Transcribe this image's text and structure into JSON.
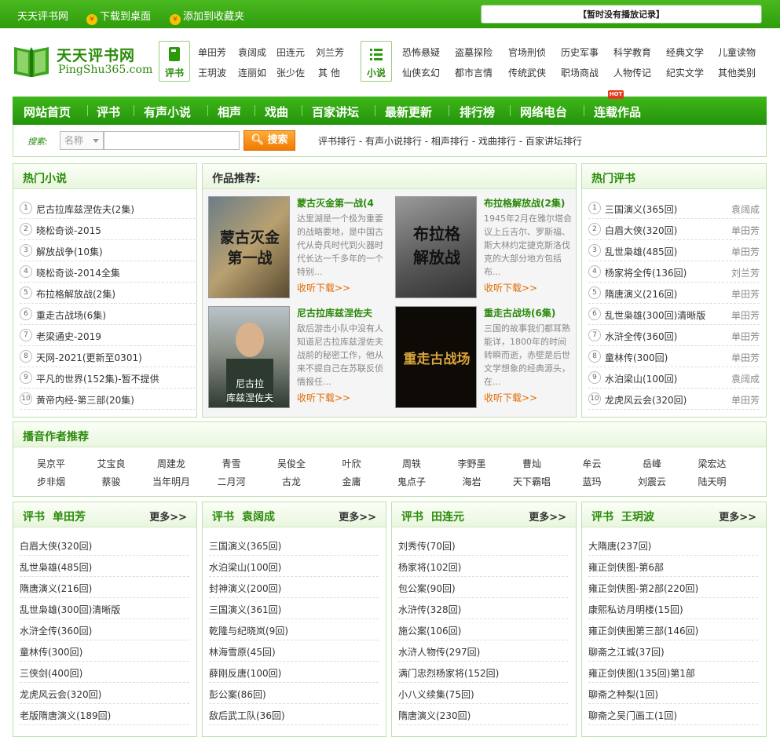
{
  "topbar": {
    "site_name": "天天评书网",
    "download_label": "下载到桌面",
    "favorite_label": "添加到收藏夹",
    "play_record": "【暂时没有播放记录】"
  },
  "logo": {
    "cn": "天天评书网",
    "en": "PingShu365.com"
  },
  "category_pingshu": {
    "label": "评书",
    "row1": [
      "单田芳",
      "袁阔成",
      "田连元",
      "刘兰芳"
    ],
    "row2": [
      "王玥波",
      "连丽如",
      "张少佐",
      "其 他"
    ]
  },
  "category_novel": {
    "label": "小说",
    "row1": [
      "恐怖悬疑",
      "盗墓探险",
      "官场刑侦",
      "历史军事",
      "科学教育",
      "经典文学",
      "儿童读物"
    ],
    "row2": [
      "仙侠玄幻",
      "都市言情",
      "传统武侠",
      "职场商战",
      "人物传记",
      "纪实文学",
      "其他类别"
    ]
  },
  "nav": [
    "网站首页",
    "评书",
    "有声小说",
    "相声",
    "戏曲",
    "百家讲坛",
    "最新更新",
    "排行榜",
    "网络电台",
    "连载作品"
  ],
  "nav_badge": "HOT",
  "search": {
    "label": "搜索:",
    "category": "名称",
    "button": "搜索",
    "links": "评书排行 - 有声小说排行 - 相声排行 - 戏曲排行 - 百家讲坛排行"
  },
  "hot_novels": {
    "title": "热门小说",
    "items": [
      {
        "n": "1",
        "t": "尼古拉库兹涅佐夫(2集)"
      },
      {
        "n": "2",
        "t": "晓松奇谈-2015"
      },
      {
        "n": "3",
        "t": "解放战争(10集)"
      },
      {
        "n": "4",
        "t": "晓松奇谈-2014全集"
      },
      {
        "n": "5",
        "t": "布拉格解放战(2集)"
      },
      {
        "n": "6",
        "t": "重走古战场(6集)"
      },
      {
        "n": "7",
        "t": "老梁通史-2019"
      },
      {
        "n": "8",
        "t": "天网-2021(更新至0301)"
      },
      {
        "n": "9",
        "t": "平凡的世界(152集)-暂不提供"
      },
      {
        "n": "10",
        "t": "黄帝内经-第三部(20集)"
      }
    ]
  },
  "recommend": {
    "title": "作品推荐:",
    "works": [
      {
        "title": "蒙古灭金第一战(4",
        "desc": "达里湖是一个极为重要的战略要地，是中国古代从奇兵时代到火器时代长达一千多年的一个特别...",
        "link": "收听下载>>",
        "cover_text": "蒙古灭金\n第一战"
      },
      {
        "title": "布拉格解放战(2集)",
        "desc": "1945年2月在雅尔塔会议上丘吉尔、罗斯福、斯大林约定捷克斯洛伐克的大部分地方包括布...",
        "link": "收听下载>>",
        "cover_text": "布拉格\n解放战"
      },
      {
        "title": "尼古拉库兹涅佐夫",
        "desc": "敌后游击小队中没有人知道尼古拉库兹涅佐夫战前的秘密工作，他从来不提自己在苏联反侦情报任...",
        "link": "收听下载>>",
        "cover_text": "尼古拉\n库兹涅佐夫"
      },
      {
        "title": "重走古战场(6集)",
        "desc": "三国的故事我们都耳熟能详，1800年的时间转瞬而逝，赤壁是后世文学想象的经典源头，在...",
        "link": "收听下载>>",
        "cover_text": "重走古战场"
      }
    ]
  },
  "hot_pingshu": {
    "title": "热门评书",
    "items": [
      {
        "n": "1",
        "t": "三国演义(365回)",
        "a": "袁阔成"
      },
      {
        "n": "2",
        "t": "白眉大侠(320回)",
        "a": "单田芳"
      },
      {
        "n": "3",
        "t": "乱世枭雄(485回)",
        "a": "单田芳"
      },
      {
        "n": "4",
        "t": "杨家将全传(136回)",
        "a": "刘兰芳"
      },
      {
        "n": "5",
        "t": "隋唐演义(216回)",
        "a": "单田芳"
      },
      {
        "n": "6",
        "t": "乱世枭雄(300回)清晰版",
        "a": "单田芳"
      },
      {
        "n": "7",
        "t": "水浒全传(360回)",
        "a": "单田芳"
      },
      {
        "n": "8",
        "t": "童林传(300回)",
        "a": "单田芳"
      },
      {
        "n": "9",
        "t": "水泊梁山(100回)",
        "a": "袁阔成"
      },
      {
        "n": "10",
        "t": "龙虎风云会(320回)",
        "a": "单田芳"
      }
    ]
  },
  "authors": {
    "title": "播音作者推荐",
    "row1": [
      "吴京平",
      "艾宝良",
      "周建龙",
      "青雪",
      "吴俊全",
      "叶欣",
      "周轶",
      "李野墨",
      "曹灿",
      "牟云",
      "岳峰",
      "梁宏达"
    ],
    "row2": [
      "步非烟",
      "蔡骏",
      "当年明月",
      "二月河",
      "古龙",
      "金庸",
      "鬼点子",
      "海岩",
      "天下霸唱",
      "蓝玛",
      "刘震云",
      "陆天明"
    ]
  },
  "columns": [
    {
      "cat": "评书",
      "name": "单田芳",
      "more": "更多>>",
      "items": [
        "白眉大侠(320回)",
        "乱世枭雄(485回)",
        "隋唐演义(216回)",
        "乱世枭雄(300回)清晰版",
        "水浒全传(360回)",
        "童林传(300回)",
        "三侠剑(400回)",
        "龙虎风云会(320回)",
        "老版隋唐演义(189回)"
      ]
    },
    {
      "cat": "评书",
      "name": "袁阔成",
      "more": "更多>>",
      "items": [
        "三国演义(365回)",
        "水泊梁山(100回)",
        "封神演义(200回)",
        "三国演义(361回)",
        "乾隆与纪晓岚(9回)",
        "林海雪原(45回)",
        "薛刚反唐(100回)",
        "彭公案(86回)",
        "敌后武工队(36回)"
      ]
    },
    {
      "cat": "评书",
      "name": "田连元",
      "more": "更多>>",
      "items": [
        "刘秀传(70回)",
        "杨家将(102回)",
        "包公案(90回)",
        "水浒传(328回)",
        "施公案(106回)",
        "水浒人物传(297回)",
        "满门忠烈杨家将(152回)",
        "小八义续集(75回)",
        "隋唐演义(230回)"
      ]
    },
    {
      "cat": "评书",
      "name": "王玥波",
      "more": "更多>>",
      "items": [
        "大隋唐(237回)",
        "雍正剑侠图-第6部",
        "雍正剑侠图-第2部(220回)",
        "康熙私访月明楼(15回)",
        "雍正剑侠图第三部(146回)",
        "聊斋之江城(37回)",
        "雍正剑侠图(135回)第1部",
        "聊斋之种梨(1回)",
        "聊斋之吴门画工(1回)"
      ]
    }
  ],
  "colors": {
    "brand_green": "#2a8a0a",
    "nav_green": "#2f9d0c",
    "link_orange": "#e06a00"
  }
}
